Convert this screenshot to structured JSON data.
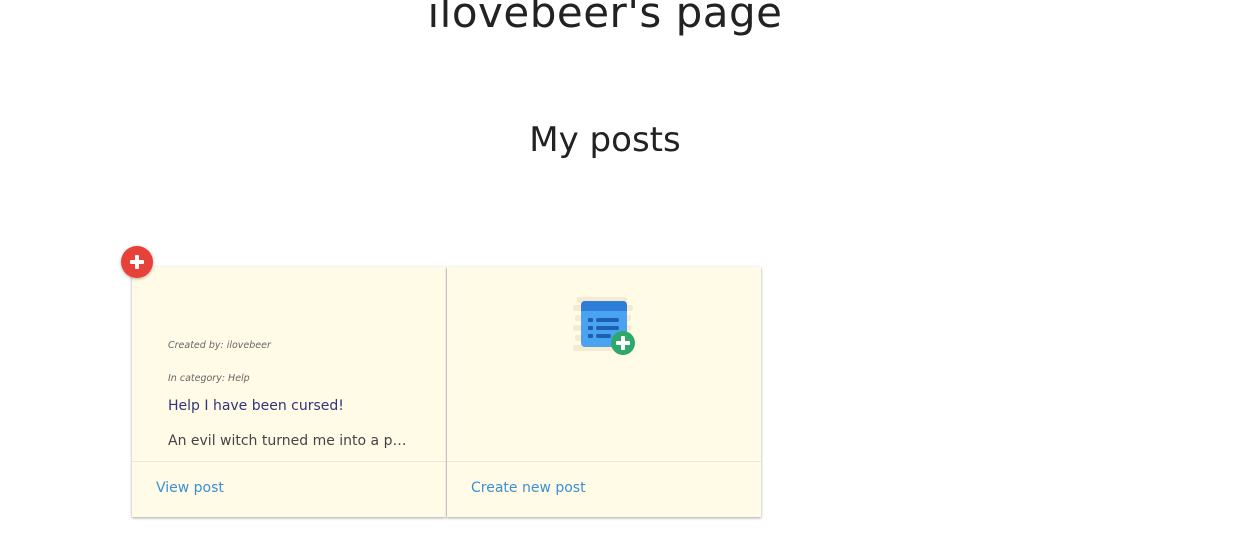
{
  "header": {
    "title": "ilovebeer's page"
  },
  "section": {
    "title": "My posts"
  },
  "posts": [
    {
      "author_line": "Created by: ilovebeer",
      "category_line": "In category: Help",
      "title": "Help I have been cursed!",
      "excerpt": "An evil witch turned me into a plat...",
      "action_label": "View post"
    }
  ],
  "new_post_card": {
    "icon": "new-post-icon",
    "action_label": "Create new post"
  },
  "colors": {
    "card_background": "#fffbe7",
    "link": "#3b8fd6",
    "badge": "#e8413a",
    "icon_blue": "#4aa3f0",
    "icon_green": "#2fa86b"
  }
}
